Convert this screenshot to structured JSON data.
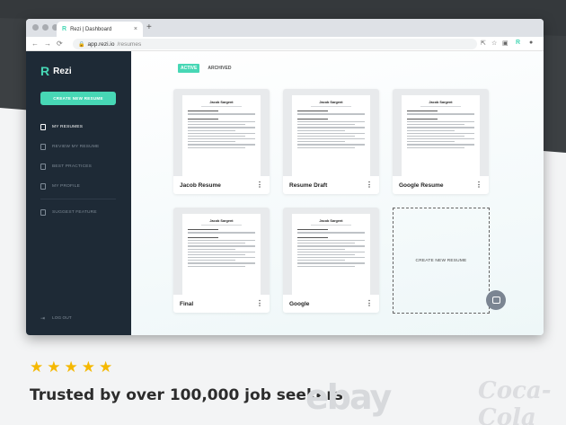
{
  "browser": {
    "tab_title": "Rezi | Dashboard",
    "url_host": "app.rezi.io",
    "url_path": "/resumes"
  },
  "sidebar": {
    "brand": "Rezi",
    "create_button": "CREATE NEW RESUME",
    "items": [
      {
        "label": "MY RESUMES",
        "icon": "document-icon",
        "active": true
      },
      {
        "label": "REVIEW MY RESUME",
        "icon": "review-icon",
        "active": false
      },
      {
        "label": "BEST PRACTICES",
        "icon": "list-icon",
        "active": false
      },
      {
        "label": "MY PROFILE",
        "icon": "profile-icon",
        "active": false
      }
    ],
    "suggest": "SUGGEST FEATURE",
    "logout": "LOG OUT"
  },
  "main": {
    "tabs": [
      {
        "label": "ACTIVE",
        "active": true
      },
      {
        "label": "ARCHIVED",
        "active": false
      }
    ],
    "resumes": [
      {
        "name": "Jacob Resume",
        "preview_name": "Jacob Sargent"
      },
      {
        "name": "Resume Draft",
        "preview_name": "Jacob Sargent"
      },
      {
        "name": "Google Resume",
        "preview_name": "Jacob Sargent"
      },
      {
        "name": "Final",
        "preview_name": "Jacob Sargent"
      },
      {
        "name": "Google",
        "preview_name": "Jacob Sargent"
      }
    ],
    "create_card": "CREATE NEW RESUME"
  },
  "promo": {
    "rating_stars": 5,
    "tagline": "Trusted by over 100,000 job seekers",
    "logos": [
      "ebay",
      "Coca-Cola"
    ]
  },
  "colors": {
    "accent": "#47d7b5",
    "sidebar": "#1e2a36",
    "star": "#f5b800"
  }
}
